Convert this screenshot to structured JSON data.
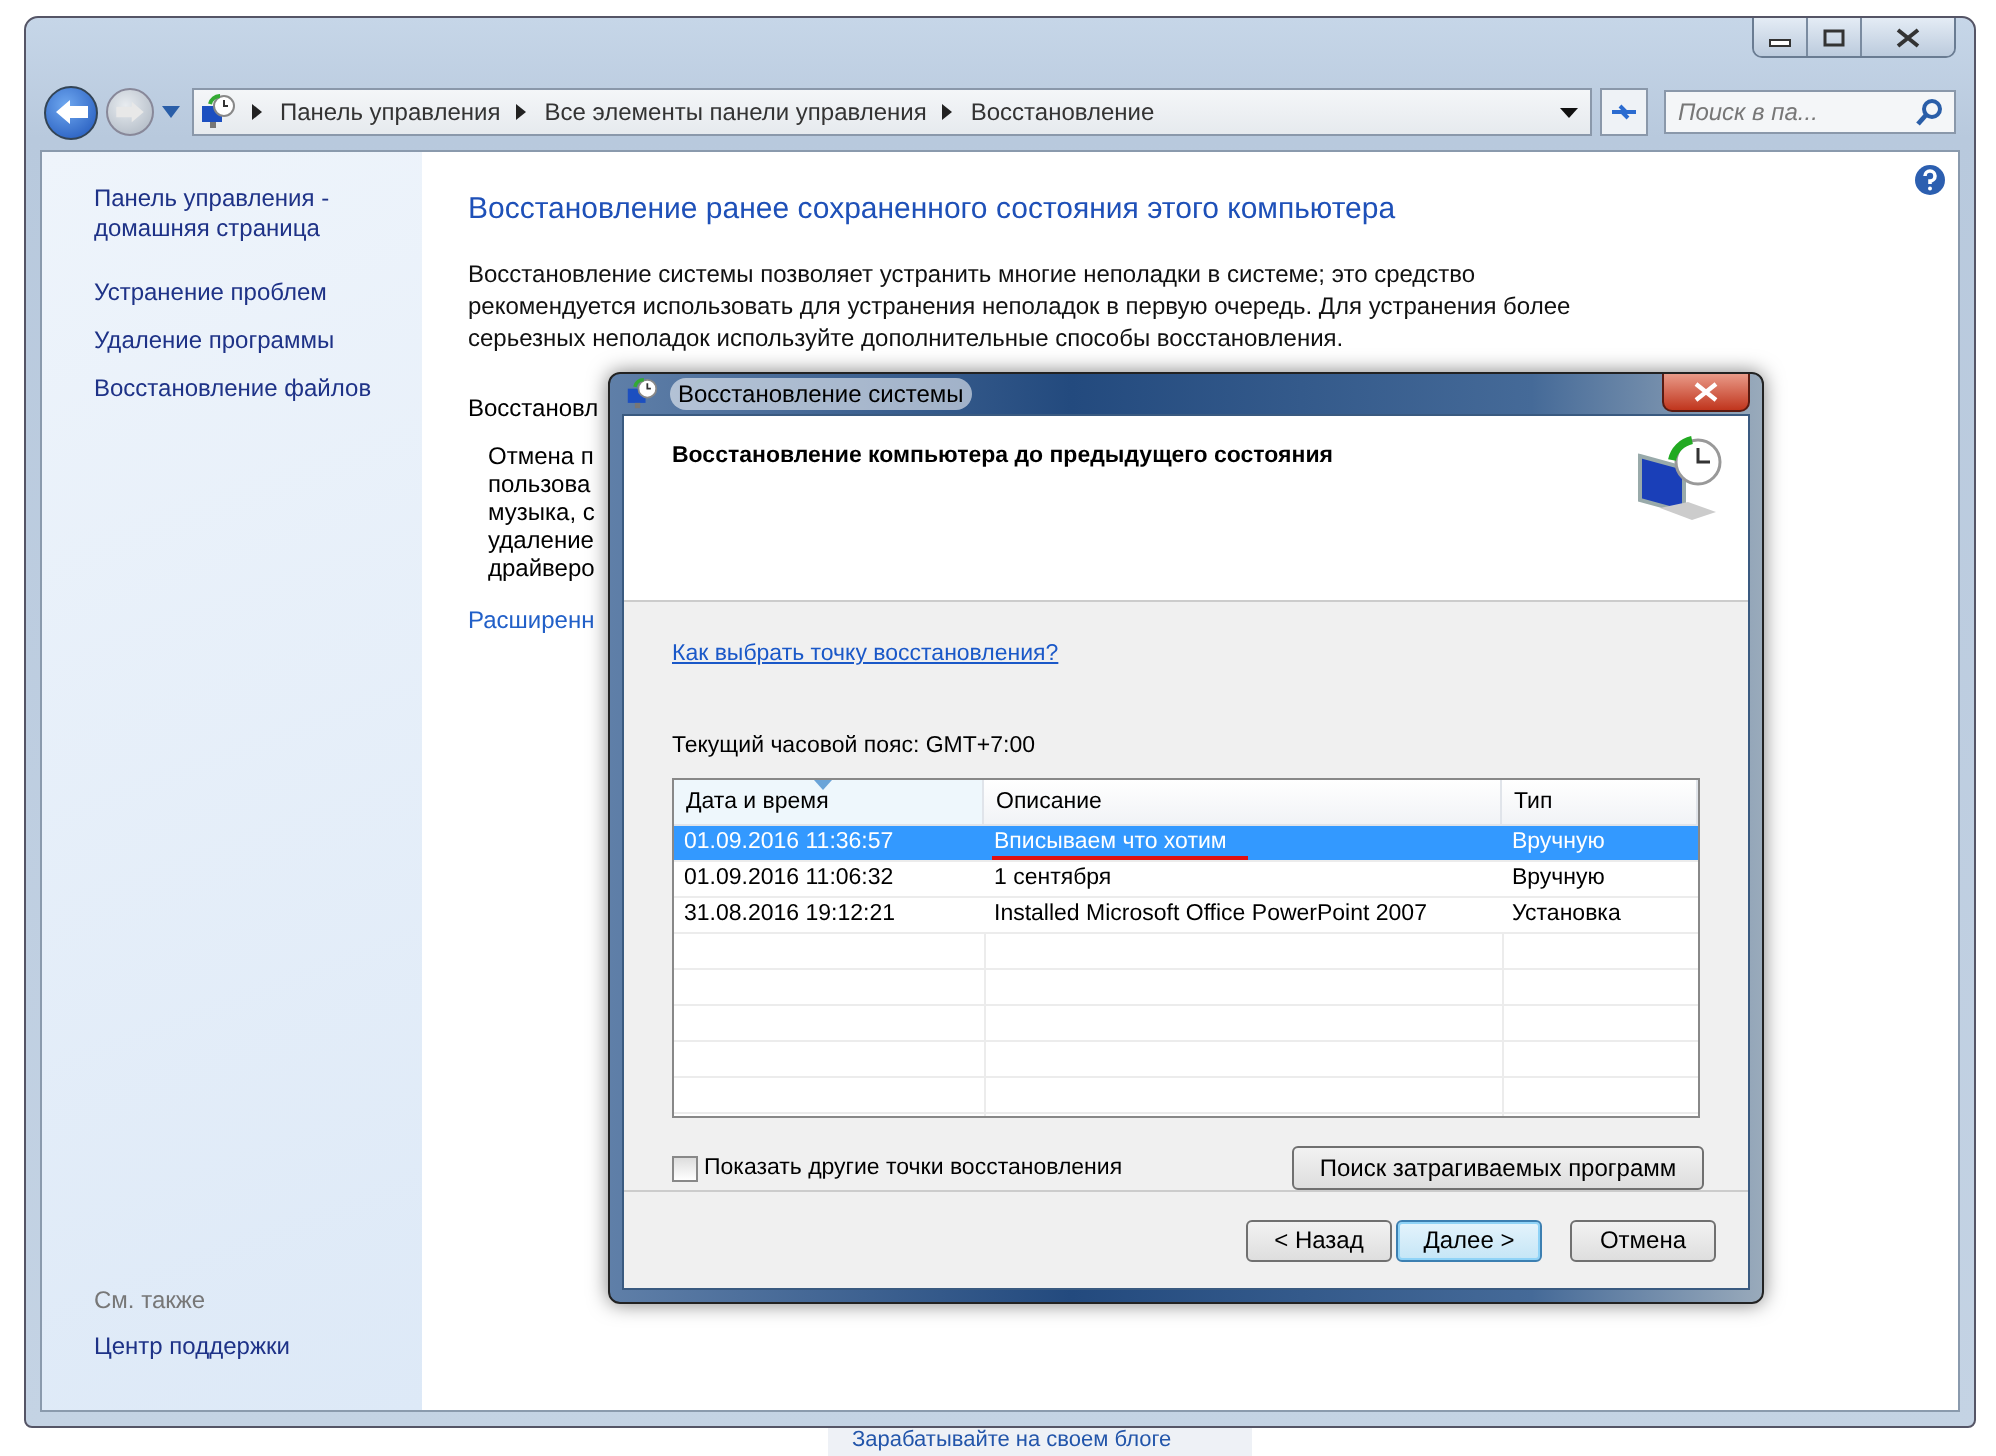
{
  "address_bar": {
    "breadcrumbs": [
      "Панель управления",
      "Все элементы панели управления",
      "Восстановление"
    ]
  },
  "search": {
    "placeholder": "Поиск в па..."
  },
  "sidebar": {
    "links": [
      "Панель управления - домашняя страница",
      "Устранение проблем",
      "Удаление программы",
      "Восстановление файлов"
    ],
    "see_also_label": "См. также",
    "see_also_links": [
      "Центр поддержки"
    ]
  },
  "main": {
    "heading": "Восстановление ранее сохраненного состояния этого компьютера",
    "description": "Восстановление системы позволяет устранить многие неполадки в системе; это средство рекомендуется использовать для устранения неполадок в первую очередь. Для устранения более серьезных неполадок используйте дополнительные способы восстановления.",
    "section_label": "Восстановл",
    "section_lines": [
      "Отмена п",
      "пользова",
      "музыка, с",
      "удаление",
      "драйверо"
    ],
    "advanced_link": "Расширенн"
  },
  "dialog": {
    "title": "Восстановление системы",
    "header": "Восстановление компьютера до предыдущего состояния",
    "help_link": "Как выбрать точку восстановления?",
    "timezone": "Текущий часовой пояс: GMT+7:00",
    "table": {
      "columns": [
        "Дата и время",
        "Описание",
        "Тип"
      ],
      "rows": [
        {
          "cells": [
            "01.09.2016 11:36:57",
            "Вписываем что хотим",
            "Вручную"
          ],
          "selected": true,
          "underlined": true
        },
        {
          "cells": [
            "01.09.2016 11:06:32",
            "1 сентября",
            "Вручную"
          ],
          "selected": false,
          "underlined": false
        },
        {
          "cells": [
            "31.08.2016 19:12:21",
            "Installed Microsoft Office PowerPoint 2007",
            "Установка"
          ],
          "selected": false,
          "underlined": false
        }
      ]
    },
    "show_more": {
      "label": "Показать другие точки восстановления",
      "checked": false
    },
    "scan_button": "Поиск затрагиваемых программ",
    "buttons": [
      {
        "label": "< Назад",
        "default": false
      },
      {
        "label": "Далее >",
        "default": true
      },
      {
        "label": "Отмена",
        "default": false
      }
    ]
  },
  "background_link": "Зарабатывайте на своем блоге"
}
